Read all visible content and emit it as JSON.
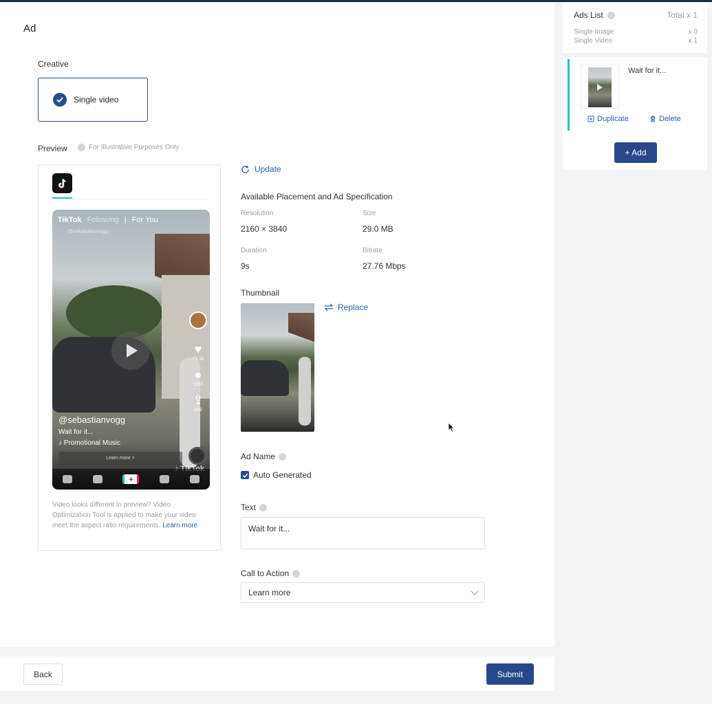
{
  "page": {
    "title": "Ad"
  },
  "creative": {
    "label": "Creative",
    "option_label": "Single video"
  },
  "preview": {
    "label": "Preview",
    "note": "For Illustrative Purposes Only",
    "phone": {
      "brand": "TikTok",
      "tab_following": "Following",
      "tab_for_you": "For You",
      "handle_small": "@sebastianvogg",
      "username": "@sebastianvogg",
      "caption": "Wait for it...",
      "music": "♪ Promotional Music",
      "learn_more": "Learn more >",
      "likes": "73.1k",
      "comments": "1281",
      "shares": "232",
      "watermark": "♪ TikTok"
    },
    "help_text": "Video looks different in preview? Video Optimization Tool is applied to make your video meet the aspect ratio requirements. ",
    "help_link": "Learn more"
  },
  "update_label": "Update",
  "spec": {
    "title": "Available Placement and Ad Specification",
    "resolution_label": "Resolution",
    "resolution": "2160 × 3840",
    "size_label": "Size",
    "size": "29.0 MB",
    "duration_label": "Duration",
    "duration": "9s",
    "bitrate_label": "Bitrate",
    "bitrate": "27.76 Mbps"
  },
  "thumbnail": {
    "label": "Thumbnail",
    "replace_label": "Replace"
  },
  "ad_name": {
    "label": "Ad Name",
    "auto_generated": "Auto Generated",
    "checked": true
  },
  "text_field": {
    "label": "Text",
    "value": "Wait for it..."
  },
  "cta": {
    "label": "Call to Action",
    "value": "Learn more"
  },
  "footer": {
    "back": "Back",
    "submit": "Submit"
  },
  "ads_list": {
    "title": "Ads List",
    "total": "Total x 1",
    "single_image_label": "Single Image",
    "single_image_count": "x 0",
    "single_video_label": "Single Video",
    "single_video_count": "x 1",
    "items": [
      {
        "title": "Wait for it..."
      }
    ],
    "duplicate": "Duplicate",
    "delete": "Delete",
    "add": "+ Add"
  },
  "colors": {
    "primary": "#28488a",
    "link": "#2b5db8",
    "accent": "#2bc0c8"
  }
}
